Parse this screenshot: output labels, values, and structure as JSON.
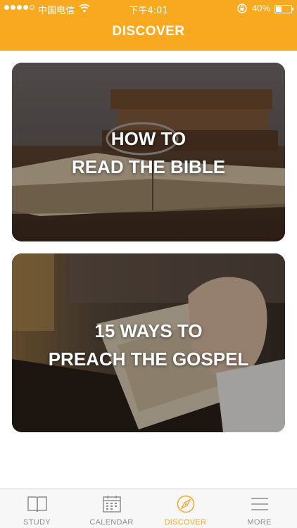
{
  "status_bar": {
    "carrier": "中国电信",
    "time": "下午4:01",
    "battery": "40%",
    "battery_level": 0.4,
    "icons": [
      "signal-dots",
      "wifi-icon",
      "rotation-lock-icon",
      "battery-icon"
    ]
  },
  "header": {
    "title": "DISCOVER",
    "color": "#f9a920"
  },
  "cards": [
    {
      "title_line1": "HOW TO",
      "title_line2": "READ THE BIBLE"
    },
    {
      "title_line1": "15 WAYS TO",
      "title_line2": "PREACH THE GOSPEL"
    }
  ],
  "tab_bar": {
    "active_color": "#f5a623",
    "inactive_color": "#8e8e8e",
    "tabs": [
      {
        "label": "STUDY",
        "icon": "book-icon",
        "active": false
      },
      {
        "label": "CALENDAR",
        "icon": "calendar-icon",
        "active": false
      },
      {
        "label": "DISCOVER",
        "icon": "compass-icon",
        "active": true
      },
      {
        "label": "MORE",
        "icon": "menu-icon",
        "active": false
      }
    ]
  }
}
